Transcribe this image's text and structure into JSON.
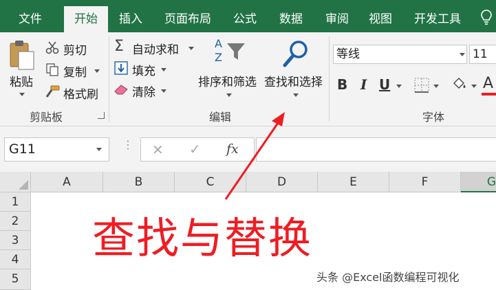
{
  "tabs": [
    "文件",
    "开始",
    "插入",
    "页面布局",
    "公式",
    "数据",
    "审阅",
    "视图",
    "开发工具"
  ],
  "active_tab": "开始",
  "clipboard": {
    "paste_label": "粘贴",
    "cut_label": "剪切",
    "copy_label": "复制",
    "format_painter_label": "格式刷",
    "group_label": "剪贴板"
  },
  "editing": {
    "autosum_label": "自动求和",
    "fill_label": "填充",
    "clear_label": "清除",
    "sort_filter_label": "排序和筛选",
    "find_select_label": "查找和选择",
    "group_label": "编辑"
  },
  "font": {
    "font_name": "等线",
    "font_size": "11",
    "bold": "B",
    "italic": "I",
    "underline": "U",
    "color_letter": "A",
    "group_label": "字体"
  },
  "formula_bar": {
    "cell_ref": "G11",
    "cancel": "✕",
    "enter": "✓",
    "fx": "fx"
  },
  "columns": [
    "A",
    "B",
    "C",
    "D",
    "E",
    "F",
    "G"
  ],
  "rows": [
    "1",
    "2",
    "3",
    "4",
    "5"
  ],
  "annotation": "查找与替换",
  "watermark": "头条 @Excel函数编程可视化",
  "colors": {
    "ribbon_green": "#217346",
    "annotation_red": "#ee1d23"
  }
}
